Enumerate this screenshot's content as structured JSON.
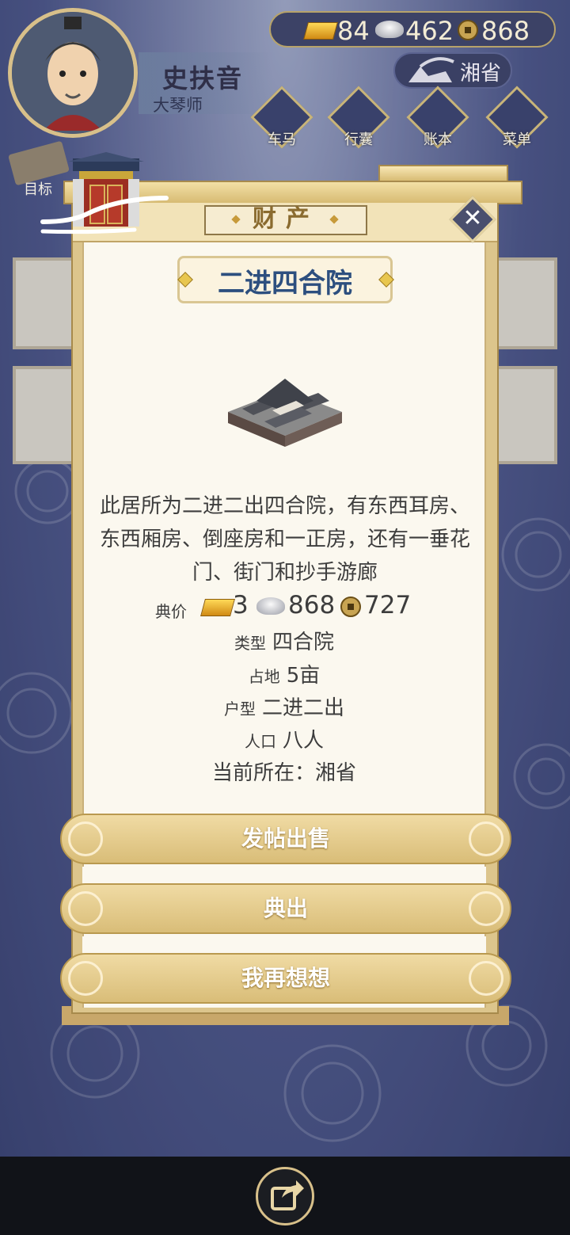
{
  "player": {
    "name": "史扶音",
    "title": "大琴师"
  },
  "currency": {
    "gold": "84",
    "silver": "462",
    "copper": "868"
  },
  "location_button": "湘省",
  "top_menu": [
    {
      "label": "车马",
      "icon": "carriage-icon"
    },
    {
      "label": "行囊",
      "icon": "bag-icon"
    },
    {
      "label": "账本",
      "icon": "ledger-icon"
    },
    {
      "label": "菜单",
      "icon": "menu-dots-icon"
    }
  ],
  "goal_label": "目标",
  "modal": {
    "title": "财产",
    "property_name": "二进四合院",
    "description": "此居所为二进二出四合院，有东西耳房、东西厢房、倒座房和一正房，还有一垂花门、街门和抄手游廊",
    "price": {
      "label": "典价",
      "gold": "3",
      "silver": "868",
      "copper": "727"
    },
    "type": {
      "key": "类型",
      "value": "四合院"
    },
    "area": {
      "key": "占地",
      "value": "5亩"
    },
    "layout": {
      "key": "户型",
      "value": "二进二出"
    },
    "population": {
      "key": "人口",
      "value": "八人"
    },
    "current_location": "当前所在：湘省",
    "buttons": {
      "sell": "发帖出售",
      "pawn": "典出",
      "cancel": "我再想想"
    }
  },
  "colors": {
    "title_blue": "#2d4f7f",
    "button_gold": "#d9bd78",
    "frame_gold": "#dcc58c"
  }
}
